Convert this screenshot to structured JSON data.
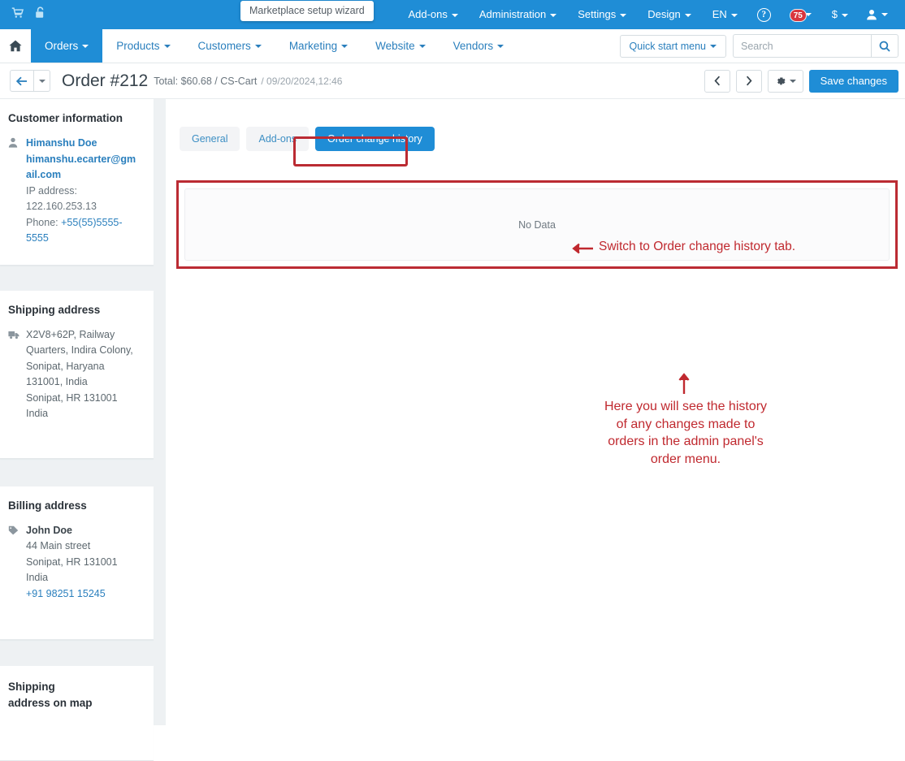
{
  "topbar": {
    "icons": [
      {
        "name": "cart-icon",
        "label": "Storefront"
      },
      {
        "name": "unlock-icon",
        "label": "Unlocked"
      }
    ],
    "wizard_tooltip": "Marketplace setup wizard",
    "menus": [
      {
        "label": "Add-ons",
        "caret": true
      },
      {
        "label": "Administration",
        "caret": true
      },
      {
        "label": "Settings",
        "caret": true
      },
      {
        "label": "Design",
        "caret": true
      },
      {
        "label": "EN",
        "caret": true
      }
    ],
    "help_icon": "?",
    "notifications_count": "75",
    "currency_label": "$",
    "account_icon": "user-icon"
  },
  "navbar": {
    "home_icon": "home-icon",
    "items": [
      {
        "label": "Orders",
        "active": true
      },
      {
        "label": "Products",
        "active": false
      },
      {
        "label": "Customers",
        "active": false
      },
      {
        "label": "Marketing",
        "active": false
      },
      {
        "label": "Website",
        "active": false
      },
      {
        "label": "Vendors",
        "active": false
      }
    ],
    "quick_start_menu": "Quick start menu",
    "search_placeholder": "Search",
    "search_value": ""
  },
  "pagehead": {
    "back_label": "←",
    "title": "Order #212",
    "meta": "Total: $60.68 / CS-Cart",
    "date": "/ 09/20/2024,12:46",
    "prev_label": "‹",
    "next_label": "›",
    "save_label": "Save changes"
  },
  "sidebar": {
    "customer": {
      "heading": "Customer information",
      "icon": "user-icon",
      "name": "Himanshu Doe",
      "email": "himanshu.ecarter@gmail.com",
      "ip_label": "IP address:",
      "ip_value": "122.160.253.13",
      "phone_label": "Phone:",
      "phone_value": "+55(55)5555-5555"
    },
    "shipping": {
      "heading": "Shipping address",
      "icon": "truck-icon",
      "lines": [
        "X2V8+62P, Railway Quarters, Indira Colony, Sonipat, Haryana 131001, India",
        "Sonipat, HR 131001",
        "India"
      ]
    },
    "billing": {
      "heading": "Billing address",
      "icon": "tag-icon",
      "name": "John Doe",
      "lines": [
        "44 Main street",
        "Sonipat, HR 131001",
        "India"
      ],
      "phone": "+91 98251 15245"
    },
    "map": {
      "heading": "Shipping address on map"
    }
  },
  "main": {
    "tabs": [
      {
        "label": "General",
        "active": false
      },
      {
        "label": "Add-ons",
        "active": false
      },
      {
        "label": "Order change history",
        "active": true
      }
    ],
    "no_data": "No Data"
  },
  "annotations": {
    "tab_note": "Switch to Order change history tab.",
    "panel_note_lines": [
      "Here you will see the history",
      "of any changes made to",
      "orders in the admin panel's",
      "order menu."
    ],
    "highlight_color": "#bb2b33",
    "text_color": "#c0292f"
  },
  "theme": {
    "primary": "#1f8dd6",
    "link": "#2a7fbd",
    "page_bg": "#eef1f3",
    "badge_red": "#d9363e"
  }
}
